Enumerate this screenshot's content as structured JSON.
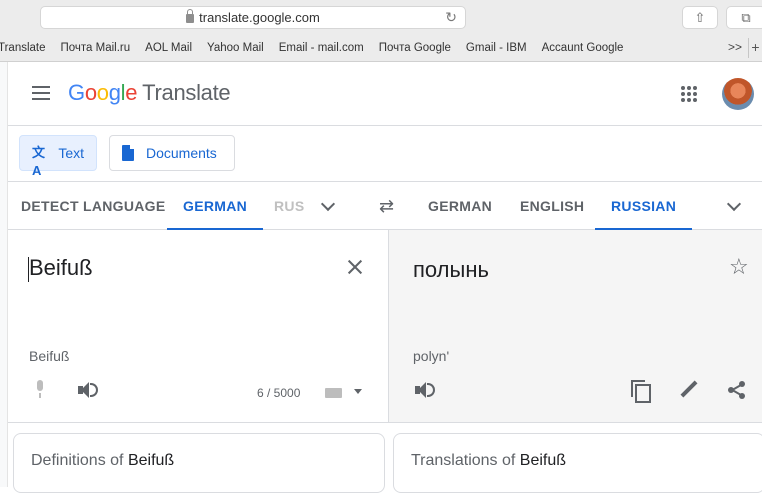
{
  "browser": {
    "url": "translate.google.com",
    "bookmarks": [
      "Translate",
      "Почта Mail.ru",
      "AOL Mail",
      "Yahoo Mail",
      "Email - mail.com",
      "Почта Google",
      "Gmail - IBM",
      "Accaunt Google"
    ],
    "more": ">>",
    "new_tab": "+"
  },
  "header": {
    "logo_letters": [
      "G",
      "o",
      "o",
      "g",
      "l",
      "e"
    ],
    "product": "Translate"
  },
  "modes": [
    {
      "label": "Text",
      "active": true
    },
    {
      "label": "Documents",
      "active": false
    }
  ],
  "source_langs": [
    {
      "label": "DETECT LANGUAGE",
      "active": false
    },
    {
      "label": "GERMAN",
      "active": true
    },
    {
      "label": "RUS",
      "active": false
    }
  ],
  "target_langs": [
    {
      "label": "GERMAN",
      "active": false
    },
    {
      "label": "ENGLISH",
      "active": false
    },
    {
      "label": "RUSSIAN",
      "active": true
    }
  ],
  "source": {
    "text": "Beifuß",
    "transliteration": "Beifuß",
    "char_count": "6 / 5000"
  },
  "target": {
    "text": "полынь",
    "transliteration": "polyn'"
  },
  "cards": {
    "definitions_prefix": "Definitions of",
    "definitions_word": "Beifuß",
    "translations_prefix": "Translations of",
    "translations_word": "Beifuß"
  },
  "colors": {
    "accent": "#1967d2",
    "target_bg": "#f5f5f5"
  }
}
